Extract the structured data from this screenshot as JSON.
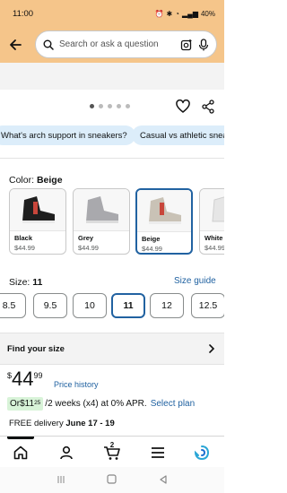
{
  "status_bar": {
    "time": "11:00",
    "battery": "40%"
  },
  "search": {
    "placeholder": "Search or ask a question"
  },
  "chips": [
    {
      "label": "What's arch support in sneakers?"
    },
    {
      "label": "Casual vs athletic snea"
    }
  ],
  "color": {
    "prefix": "Color: ",
    "selected": "Beige"
  },
  "variants": [
    {
      "name": "Black",
      "price": "$44.99",
      "color": "#1f1f1f"
    },
    {
      "name": "Grey",
      "price": "$44.99",
      "color": "#a9a9ad"
    },
    {
      "name": "Beige",
      "price": "$44.99",
      "color": "#c9c2b6"
    },
    {
      "name": "White",
      "price": "$44.99",
      "color": "#e6e6e6"
    }
  ],
  "size": {
    "prefix": "Size: ",
    "selected": "11",
    "guide_label": "Size guide"
  },
  "sizes": [
    "8.5",
    "9.5",
    "10",
    "11",
    "12",
    "12.5"
  ],
  "find_size": {
    "label": "Find your size"
  },
  "price": {
    "currency": "$",
    "whole": "44",
    "fraction": "99",
    "history_label": "Price history"
  },
  "installment": {
    "prefix": "Or ",
    "currency": "$",
    "whole": "11",
    "fraction": "25",
    "text": "/2 weeks (x4) at 0% APR.",
    "select_plan": "Select plan"
  },
  "delivery": {
    "prefix": "FREE delivery ",
    "dates": "June 17 - 19"
  },
  "nav": {
    "cart_count": "2"
  },
  "colors": {
    "accent": "#2162a1",
    "header": "#f5c58a",
    "chip": "#dcedfa"
  }
}
